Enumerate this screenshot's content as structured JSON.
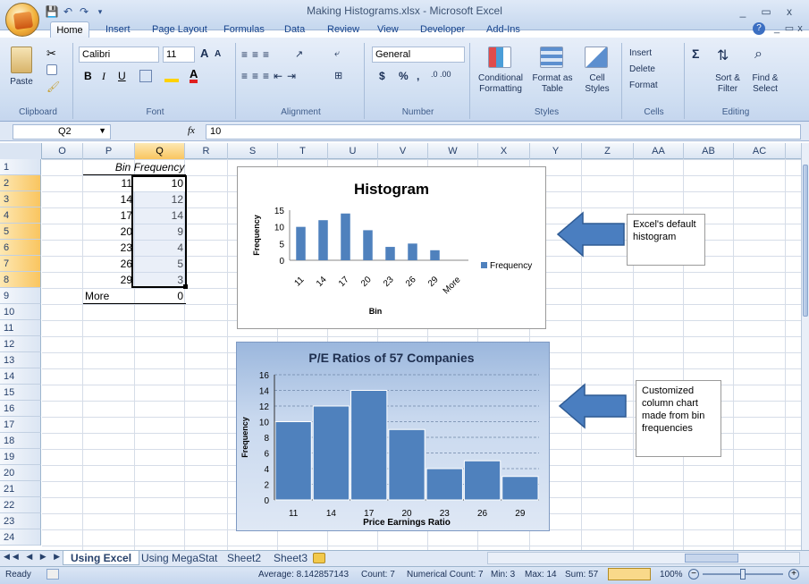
{
  "window": {
    "title": "Making Histograms.xlsx - Microsoft Excel",
    "controls": [
      "_",
      "▭",
      "x"
    ],
    "doc_controls": [
      "?",
      "_",
      "▭",
      "x"
    ]
  },
  "tabs": [
    "Home",
    "Insert",
    "Page Layout",
    "Formulas",
    "Data",
    "Review",
    "View",
    "Developer",
    "Add-Ins"
  ],
  "active_tab": "Home",
  "ribbon": {
    "clipboard": {
      "label": "Clipboard",
      "paste": "Paste"
    },
    "font": {
      "label": "Font",
      "name": "Calibri",
      "size": "11",
      "bold": "B",
      "italic": "I",
      "underline": "U"
    },
    "alignment": {
      "label": "Alignment"
    },
    "number": {
      "label": "Number",
      "format": "General",
      "currency": "$",
      "percent": "%",
      "comma": ","
    },
    "styles": {
      "label": "Styles",
      "conditional": "Conditional Formatting",
      "format_table": "Format as Table",
      "cell_styles": "Cell Styles"
    },
    "cells": {
      "label": "Cells",
      "insert": "Insert",
      "delete": "Delete",
      "format": "Format"
    },
    "editing": {
      "label": "Editing",
      "sum": "Σ",
      "sort": "Sort & Filter",
      "find": "Find & Select"
    }
  },
  "formula_bar": {
    "name_box": "Q2",
    "fx": "fx",
    "value": "10"
  },
  "columns": [
    "O",
    "P",
    "Q",
    "R",
    "S",
    "T",
    "U",
    "V",
    "W",
    "X",
    "Y",
    "Z",
    "AA",
    "AB",
    "AC"
  ],
  "selected_column": "Q",
  "rows": [
    "1",
    "2",
    "3",
    "4",
    "5",
    "6",
    "7",
    "8",
    "9",
    "10",
    "11",
    "12",
    "13",
    "14",
    "15",
    "16",
    "17",
    "18",
    "19",
    "20",
    "21",
    "22",
    "23",
    "24"
  ],
  "table": {
    "header_bin": "Bin",
    "header_freq": "Frequency",
    "bins": [
      "11",
      "14",
      "17",
      "20",
      "23",
      "26",
      "29",
      "More"
    ],
    "frequencies": [
      "10",
      "12",
      "14",
      "9",
      "4",
      "5",
      "3",
      "0"
    ]
  },
  "chart_data": [
    {
      "type": "bar",
      "title": "Histogram",
      "xlabel": "Bin",
      "ylabel": "Frequency",
      "categories": [
        "11",
        "14",
        "17",
        "20",
        "23",
        "26",
        "29",
        "More"
      ],
      "series": [
        {
          "name": "Frequency",
          "values": [
            10,
            12,
            14,
            9,
            4,
            5,
            3,
            0
          ]
        }
      ],
      "ylim": [
        0,
        15
      ],
      "yticks": [
        "0",
        "5",
        "10",
        "15"
      ],
      "legend": "right",
      "color": "#4f81bd"
    },
    {
      "type": "bar",
      "title": "P/E Ratios of 57 Companies",
      "xlabel": "Price Earnings Ratio",
      "ylabel": "Frequency",
      "categories": [
        "11",
        "14",
        "17",
        "20",
        "23",
        "26",
        "29"
      ],
      "values": [
        10,
        12,
        14,
        9,
        4,
        5,
        3
      ],
      "ylim": [
        0,
        16
      ],
      "yticks": [
        "0",
        "2",
        "4",
        "6",
        "8",
        "10",
        "12",
        "14",
        "16"
      ],
      "grid": true,
      "color": "#4f81bd"
    }
  ],
  "callouts": {
    "top": "Excel's default histogram",
    "bottom": "Customized column chart made from bin frequencies"
  },
  "sheet_tabs": [
    "Using Excel",
    "Using MegaStat",
    "Sheet2",
    "Sheet3"
  ],
  "active_sheet": "Using Excel",
  "status": {
    "ready": "Ready",
    "average": "Average: 8.142857143",
    "count": "Count: 7",
    "numerical_count": "Numerical Count: 7",
    "min": "Min: 3",
    "max": "Max: 14",
    "sum": "Sum: 57",
    "zoom": "100%"
  }
}
